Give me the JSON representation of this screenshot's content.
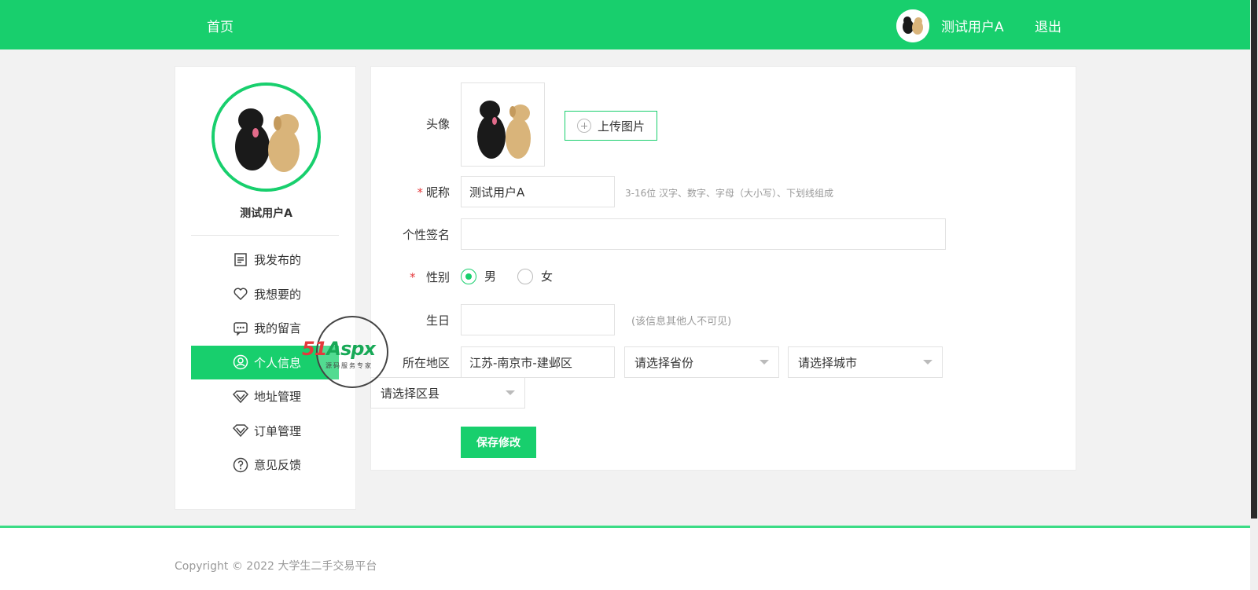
{
  "header": {
    "home_label": "首页",
    "username": "测试用户A",
    "logout_label": "退出"
  },
  "sidebar": {
    "username": "测试用户A",
    "items": [
      {
        "label": "我发布的",
        "icon": "document-list-icon"
      },
      {
        "label": "我想要的",
        "icon": "heart-icon"
      },
      {
        "label": "我的留言",
        "icon": "message-dots-icon"
      },
      {
        "label": "个人信息",
        "icon": "user-circle-icon",
        "active": true
      },
      {
        "label": "地址管理",
        "icon": "diamond-icon"
      },
      {
        "label": "订单管理",
        "icon": "diamond-icon"
      },
      {
        "label": "意见反馈",
        "icon": "question-circle-icon"
      }
    ]
  },
  "form": {
    "avatar_label": "头像",
    "upload_label": "上传图片",
    "nickname_label": "昵称",
    "nickname_value": "测试用户A",
    "nickname_hint": "3-16位 汉字、数字、字母（大小写）、下划线组成",
    "signature_label": "个性签名",
    "signature_value": "",
    "gender_label": "性别",
    "gender_options": [
      "男",
      "女"
    ],
    "gender_selected": "男",
    "birthday_label": "生日",
    "birthday_value": "",
    "birthday_hint": "(该信息其他人不可见)",
    "region_label": "所在地区",
    "region_value": "江苏-南京市-建邺区",
    "province_placeholder": "请选择省份",
    "city_placeholder": "请选择城市",
    "district_placeholder": "请选择区县",
    "save_label": "保存修改",
    "required_mark": "*"
  },
  "watermark": {
    "brand_red": "51",
    "brand_green": "Aspx",
    "tagline": "源码服务专家"
  },
  "footer": {
    "copyright": "Copyright © 2022 大学生二手交易平台"
  },
  "colors": {
    "brand_green": "#18cf6d",
    "required_red": "#e4393c"
  }
}
